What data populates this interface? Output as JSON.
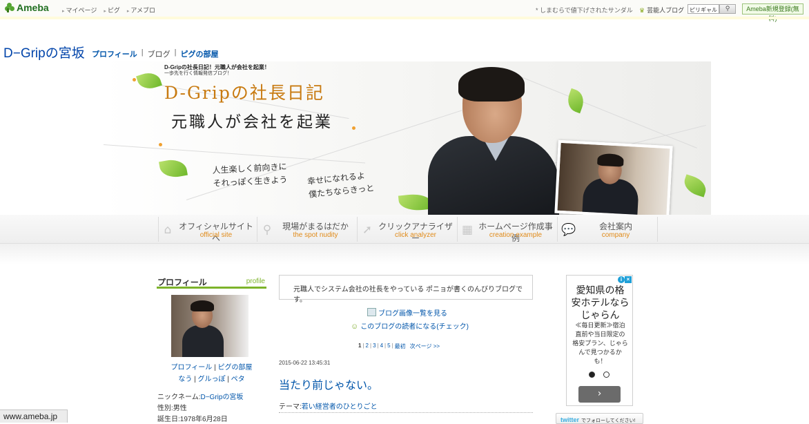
{
  "topbar": {
    "logo": "Ameba",
    "nav": [
      "マイページ",
      "ピグ",
      "アメブロ"
    ],
    "notice": "* しまむらで値下げされたサンダル",
    "celeb_link": "芸能人ブログ",
    "search_value": "ピリギャル",
    "register": "Ameba新規登録(無料)"
  },
  "blog": {
    "title": "D−Gripの宮坂",
    "links": {
      "profile": "プロフィール",
      "blog": "ブログ",
      "pig_room": "ピグの部屋"
    }
  },
  "banner": {
    "small1": "D-Gripの社長日記！元職人が会社を起業！",
    "small2": "一歩先を行く情報発信ブログ！",
    "title": "D-Gripの社長日記",
    "subtitle": "元職人が会社を起業",
    "hand1_line1": "人生楽しく前向きに",
    "hand1_line2": "それっぽく生きよう",
    "hand2_line1": "幸せになれるよ",
    "hand2_line2": "僕たちならきっと"
  },
  "nav": [
    {
      "jp": "オフィシャルサイトへ",
      "en": "official site",
      "icon": "home-icon"
    },
    {
      "jp": "現場がまるはだか",
      "en": "the spot nudity",
      "icon": "magnifier-icon"
    },
    {
      "jp": "クリックアナライザー",
      "en": "click analyzer",
      "icon": "cursor-icon"
    },
    {
      "jp": "ホームページ作成事例",
      "en": "creation example",
      "icon": "grid-icon"
    },
    {
      "jp": "会社案内",
      "en": "company",
      "icon": "speech-bubble-icon"
    }
  ],
  "sidebar": {
    "heading_jp": "プロフィール",
    "heading_en": "profile",
    "links_row1": [
      "プロフィール",
      "ピグの部屋"
    ],
    "links_row2": [
      "なう",
      "グルっぽ",
      "ペタ"
    ],
    "nickname_label": "ニックネーム:",
    "nickname": "D−Gripの宮坂",
    "gender": "性別:男性",
    "birthday": "誕生日:1978年6月28日"
  },
  "main": {
    "description": "元職人でシステム会社の社長をやっている ポニョが書くのんびりブログです。",
    "image_list": "ブログ画像一覧を見る",
    "reader": "このブログの読者になる(チェック)",
    "pager": [
      "1",
      "2",
      "3",
      "4",
      "5"
    ],
    "pager_last": "最初",
    "pager_next": "次ページ >>",
    "date": "2015-06-22 13:45:31",
    "post_title": "当たり前じゃない。",
    "theme_label": "テーマ:",
    "theme": "若い経営者のひとりごと"
  },
  "ad": {
    "headline_l1": "愛知県の格",
    "headline_l2": "安ホテルなら",
    "headline_l3": "じゃらん",
    "body_l1": "≪毎日更新≫宿泊",
    "body_l2": "直前や当日限定の",
    "body_l3": "格安プラン、じゃら",
    "body_l4": "んで見つかるか",
    "body_l5": "も！",
    "next": "›"
  },
  "twitter": {
    "brand": "twitter",
    "label": "でフォローしてください!"
  },
  "status": "www.ameba.jp"
}
